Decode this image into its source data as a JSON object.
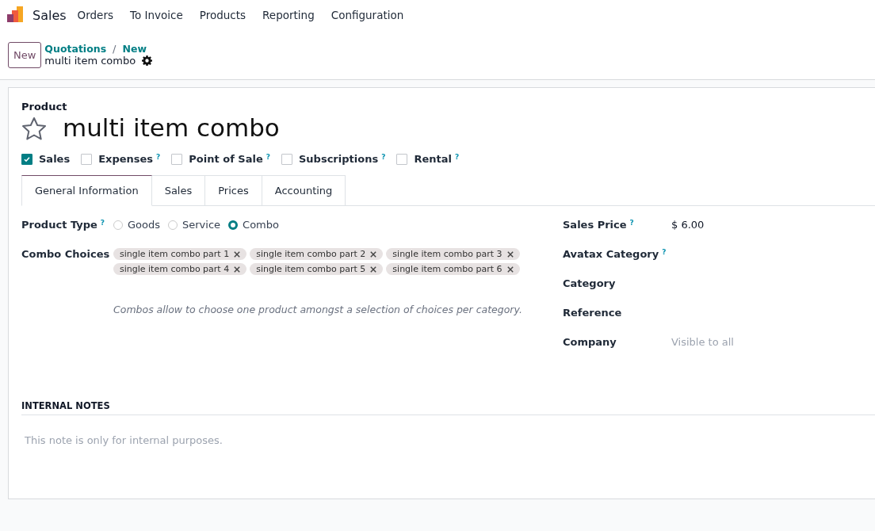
{
  "navbar": {
    "app": "Sales",
    "menu": [
      "Orders",
      "To Invoice",
      "Products",
      "Reporting",
      "Configuration"
    ]
  },
  "control_panel": {
    "new_button": "New",
    "breadcrumbs": [
      "Quotations",
      "New"
    ],
    "separator": "/",
    "record": "multi item combo"
  },
  "form": {
    "label": "Product",
    "name": "multi item combo",
    "favorite": false,
    "flags": [
      {
        "label": "Sales",
        "checked": true
      },
      {
        "label": "Expenses",
        "checked": false,
        "help": "?"
      },
      {
        "label": "Point of Sale",
        "checked": false,
        "help": "?"
      },
      {
        "label": "Subscriptions",
        "checked": false,
        "help": "?"
      },
      {
        "label": "Rental",
        "checked": false,
        "help": "?"
      }
    ],
    "tabs": [
      {
        "label": "General Information",
        "selected": true
      },
      {
        "label": "Sales",
        "selected": false
      },
      {
        "label": "Prices",
        "selected": false
      },
      {
        "label": "Accounting",
        "selected": false
      }
    ],
    "product_type": {
      "label": "Product Type",
      "help": "?",
      "options": [
        {
          "label": "Goods",
          "selected": false
        },
        {
          "label": "Service",
          "selected": false
        },
        {
          "label": "Combo",
          "selected": true
        }
      ]
    },
    "combo_choices": {
      "label": "Combo Choices",
      "tags": [
        "single item combo part 1",
        "single item combo part 2",
        "single item combo part 3",
        "single item combo part 4",
        "single item combo part 5",
        "single item combo part 6"
      ],
      "hint": "Combos allow to choose one product amongst a selection of choices per category."
    },
    "right_fields": [
      {
        "label": "Sales Price",
        "help": "?",
        "value": "$ 6.00"
      },
      {
        "label": "Avatax Category",
        "help": "?"
      },
      {
        "label": "Category"
      },
      {
        "label": "Reference"
      },
      {
        "label": "Company",
        "placeholder": "Visible to all"
      }
    ],
    "internal_notes": {
      "title": "INTERNAL NOTES",
      "placeholder": "This note is only for internal purposes."
    }
  }
}
